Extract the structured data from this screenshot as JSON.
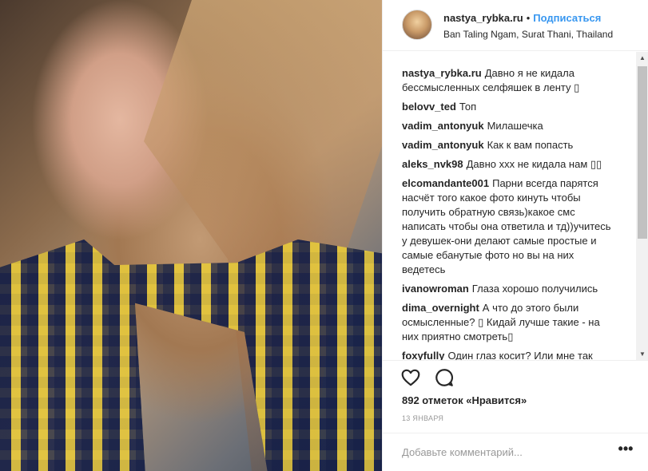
{
  "post": {
    "username": "nastya_rybka.ru",
    "separator": "•",
    "follow_label": "Подписаться",
    "location": "Ban Taling Ngam, Surat Thani, Thailand"
  },
  "comments": [
    {
      "author": "nastya_rybka.ru",
      "text": "Давно я не кидала бессмысленных селфяшек в ленту ▯"
    },
    {
      "author": "belovv_ted",
      "text": "Топ"
    },
    {
      "author": "vadim_antonyuk",
      "text": "Милашечка"
    },
    {
      "author": "vadim_antonyuk",
      "text": "Как к вам попасть"
    },
    {
      "author": "aleks_nvk98",
      "text": "Давно xxx не кидала нам ▯▯"
    },
    {
      "author": "elcomandante001",
      "text": "Парни всегда парятся насчёт того какое фото кинуть чтобы получить обратную связь)какое смс написать чтобы она ответила и тд))учитесь у девушек-они делают самые простые и самые ебанутые фото но вы на них ведетесь"
    },
    {
      "author": "ivanowroman",
      "text": "Глаза хорошо получились"
    },
    {
      "author": "dima_overnight",
      "text": "А что до этого были осмысленные? ▯ Кидай лучше такие - на них приятно смотреть▯"
    },
    {
      "author": "foxyfully",
      "text": "Один глаз косит? Или мне так"
    }
  ],
  "likes_text": "892 отметок «Нравится»",
  "date_text": "13 ЯНВАРЯ",
  "add_comment": {
    "placeholder": "Добавьте комментарий..."
  },
  "more_label": "•••",
  "scrollbar": {
    "up_arrow": "▲",
    "down_arrow": "▼"
  },
  "icons": {
    "like": "heart-icon",
    "comment": "speech-bubble-icon",
    "more": "ellipsis-icon"
  },
  "colors": {
    "accent": "#3897f0",
    "text": "#262626",
    "muted": "#999999",
    "border": "#efefef"
  }
}
